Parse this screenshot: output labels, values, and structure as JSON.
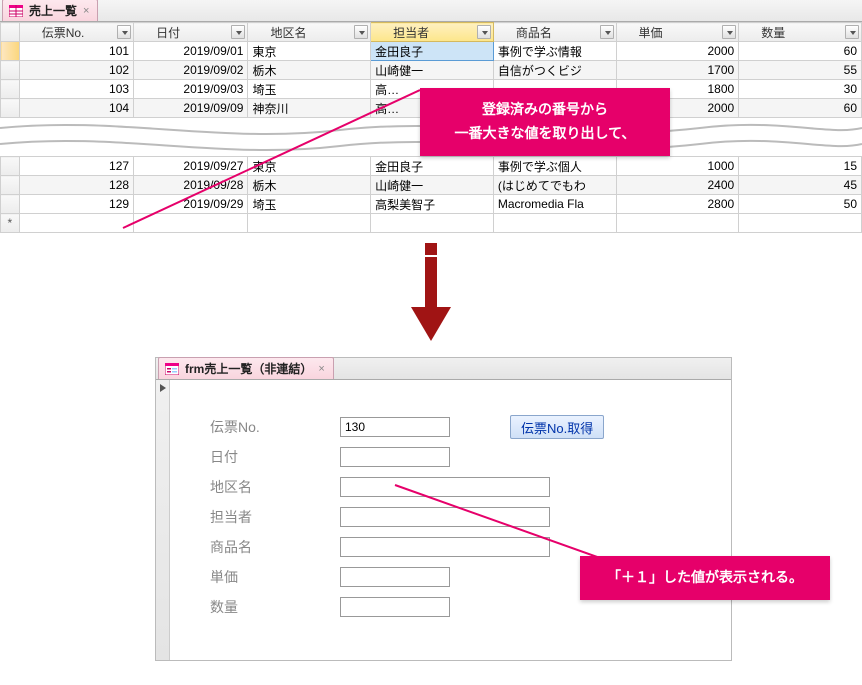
{
  "tabs": {
    "datasheet": "売上一覧",
    "form": "frm売上一覧（非連結）"
  },
  "columns": [
    "伝票No.",
    "日付",
    "地区名",
    "担当者",
    "商品名",
    "単価",
    "数量"
  ],
  "rows_top": [
    {
      "no": 101,
      "date": "2019/09/01",
      "area": "東京",
      "rep": "金田良子",
      "prod": "事例で学ぶ情報",
      "price": 2000,
      "qty": 60
    },
    {
      "no": 102,
      "date": "2019/09/02",
      "area": "栃木",
      "rep": "山崎健一",
      "prod": "自信がつくビジ",
      "price": 1700,
      "qty": 55
    },
    {
      "no": 103,
      "date": "2019/09/03",
      "area": "埼玉",
      "rep": "高…",
      "prod": "",
      "price": 1800,
      "qty": 30
    },
    {
      "no": 104,
      "date": "2019/09/09",
      "area": "神奈川",
      "rep": "高…",
      "prod": "",
      "price": 2000,
      "qty": 60
    }
  ],
  "rows_bottom": [
    {
      "no": 127,
      "date": "2019/09/27",
      "area": "東京",
      "rep": "金田良子",
      "prod": "事例で学ぶ個人",
      "price": 1000,
      "qty": 15
    },
    {
      "no": 128,
      "date": "2019/09/28",
      "area": "栃木",
      "rep": "山崎健一",
      "prod": "(はじめてでもわ",
      "price": 2400,
      "qty": 45
    },
    {
      "no": 129,
      "date": "2019/09/29",
      "area": "埼玉",
      "rep": "高梨美智子",
      "prod": "Macromedia Fla",
      "price": 2800,
      "qty": 50
    }
  ],
  "callout1_line1": "登録済みの番号から",
  "callout1_line2": "一番大きな値を取り出して、",
  "callout2": "「＋１」した値が表示される。",
  "form": {
    "labels": {
      "no": "伝票No.",
      "date": "日付",
      "area": "地区名",
      "rep": "担当者",
      "prod": "商品名",
      "price": "単価",
      "qty": "数量"
    },
    "values": {
      "no": "130"
    },
    "button": "伝票No.取得"
  }
}
